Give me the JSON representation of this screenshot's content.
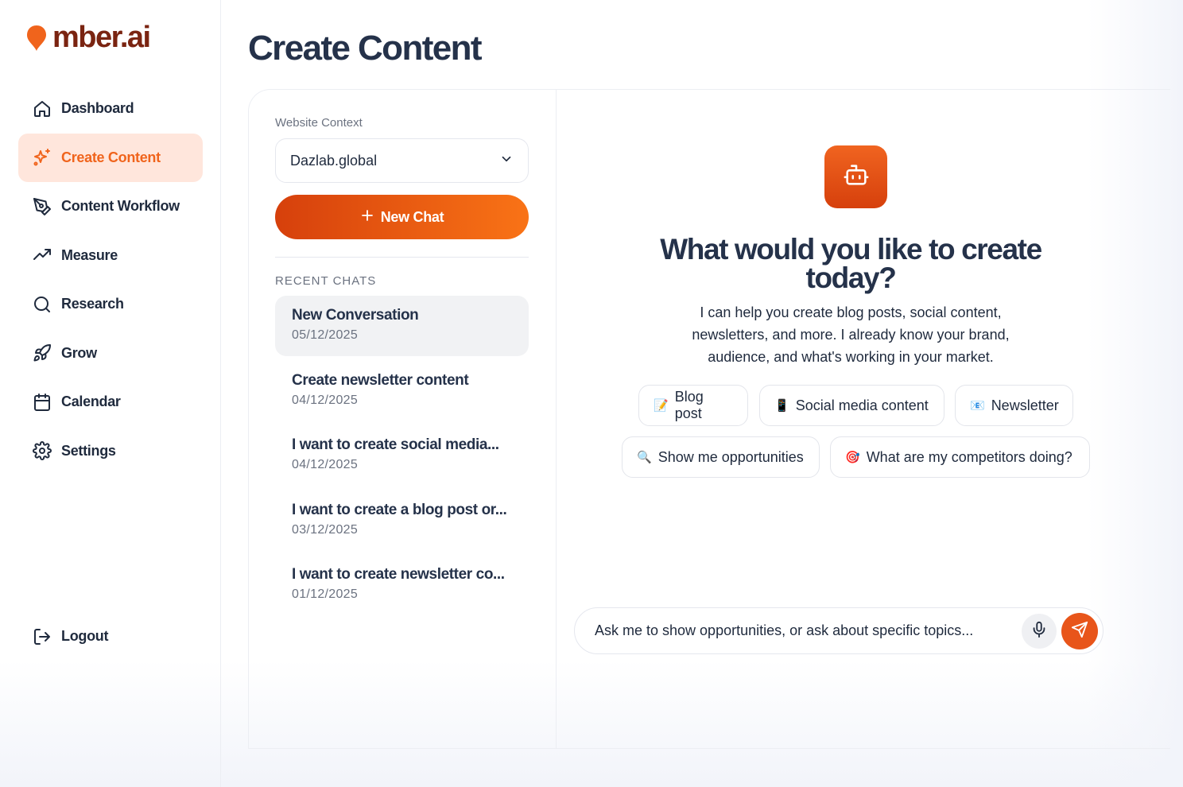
{
  "app": {
    "logo_text": "mber.ai",
    "brand_color": "#f0641c"
  },
  "sidebar": {
    "items": [
      {
        "label": "Dashboard",
        "icon": "home-icon"
      },
      {
        "label": "Create Content",
        "icon": "sparkles-icon",
        "active": true
      },
      {
        "label": "Content Workflow",
        "icon": "pen-tool-icon"
      },
      {
        "label": "Measure",
        "icon": "trending-up-icon"
      },
      {
        "label": "Research",
        "icon": "search-icon"
      },
      {
        "label": "Grow",
        "icon": "rocket-icon"
      },
      {
        "label": "Calendar",
        "icon": "calendar-icon"
      },
      {
        "label": "Settings",
        "icon": "gear-icon"
      }
    ],
    "logout_label": "Logout"
  },
  "page": {
    "title": "Create Content"
  },
  "chat_panel": {
    "context_label": "Website Context",
    "context_value": "Dazlab.global",
    "new_chat_label": "New Chat",
    "recent_label": "RECENT CHATS",
    "chats": [
      {
        "title": "New Conversation",
        "date": "05/12/2025"
      },
      {
        "title": "Create newsletter content",
        "date": "04/12/2025"
      },
      {
        "title": "I want to create social media...",
        "date": "04/12/2025"
      },
      {
        "title": "I want to create a blog post or...",
        "date": "03/12/2025"
      },
      {
        "title": "I want to create newsletter co...",
        "date": "01/12/2025"
      }
    ]
  },
  "assistant": {
    "title": "What would you like to create today?",
    "subtitle": "I can help you create blog posts, social content, newsletters, and more. I already know your brand, audience, and what's working in your market.",
    "suggestions": [
      {
        "emoji": "📝",
        "label": "Blog post"
      },
      {
        "emoji": "📱",
        "label": "Social media content"
      },
      {
        "emoji": "📧",
        "label": "Newsletter"
      },
      {
        "emoji": "🔍",
        "label": "Show me opportunities"
      },
      {
        "emoji": "🎯",
        "label": "What are my competitors doing?"
      }
    ],
    "input_placeholder": "Ask me to show opportunities, or ask about specific topics..."
  }
}
